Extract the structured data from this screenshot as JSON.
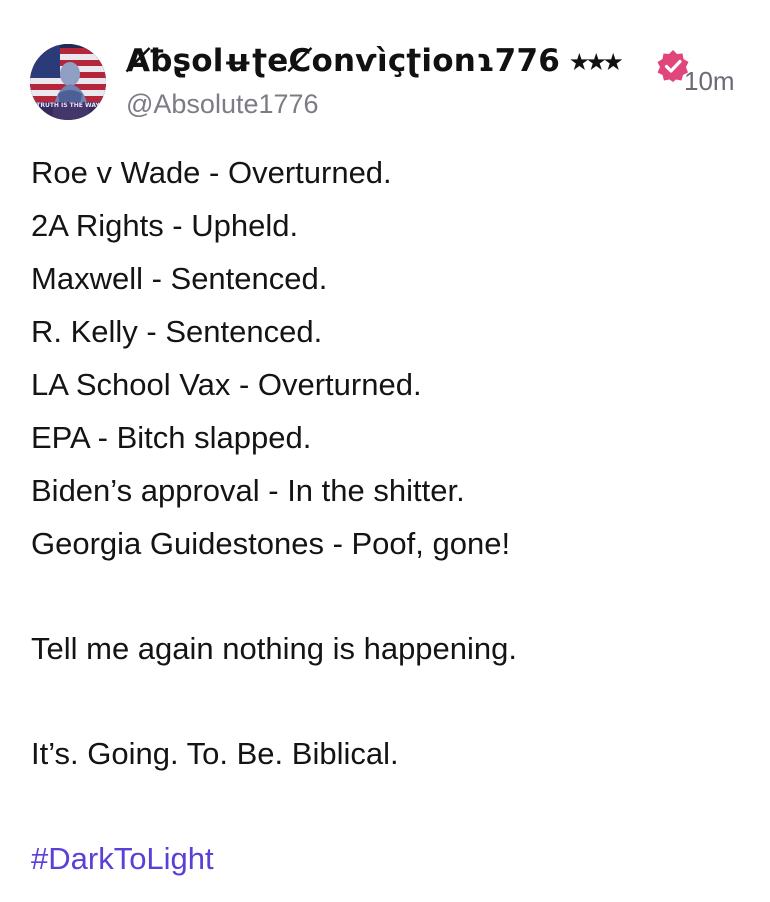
{
  "author": {
    "display_name": "ȺƀʂolʉʈeȻonѵìçʈionɿ776 ⭑⭑⭑",
    "handle": "@Absolute1776",
    "avatar_text": "TRUTH IS THE WAY",
    "verified_icon": "verified-badge-icon",
    "verified_color": "#e0457b"
  },
  "timestamp": "10m",
  "body": {
    "lines": [
      "Roe v Wade - Overturned.",
      "2A Rights - Upheld.",
      "Maxwell - Sentenced.",
      "R. Kelly - Sentenced.",
      "LA School Vax - Overturned.",
      "EPA - Bitch slapped.",
      "Biden’s approval - In the shitter.",
      "Georgia Guidestones - Poof, gone!"
    ],
    "paragraph_2": "Tell me again nothing is happening.",
    "paragraph_3": "It’s. Going. To. Be. Biblical.",
    "hashtag": "#DarkToLight"
  },
  "colors": {
    "text": "#141414",
    "muted": "#7c7c86",
    "hashtag": "#5b3fd6"
  }
}
